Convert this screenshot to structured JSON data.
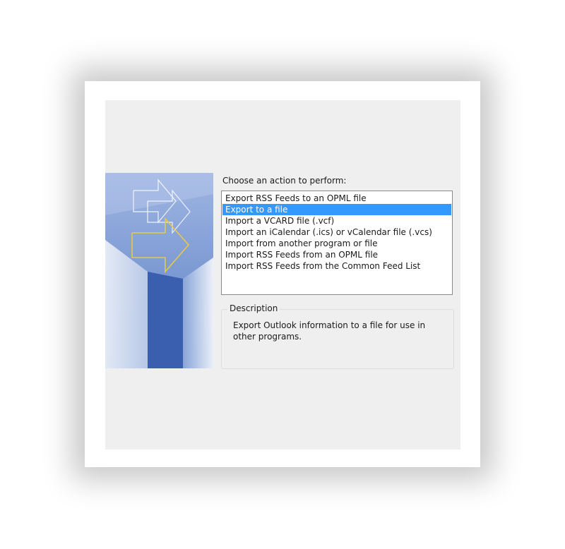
{
  "dialog": {
    "prompt": "Choose an action to perform:",
    "actions": [
      {
        "label": "Export RSS Feeds to an OPML file",
        "selected": false
      },
      {
        "label": "Export to a file",
        "selected": true
      },
      {
        "label": "Import a VCARD file (.vcf)",
        "selected": false
      },
      {
        "label": "Import an iCalendar (.ics) or vCalendar file (.vcs)",
        "selected": false
      },
      {
        "label": "Import from another program or file",
        "selected": false
      },
      {
        "label": "Import RSS Feeds from an OPML file",
        "selected": false
      },
      {
        "label": "Import RSS Feeds from the Common Feed List",
        "selected": false
      }
    ],
    "description": {
      "title": "Description",
      "text": "Export Outlook information to a file for use in other programs."
    }
  },
  "colors": {
    "selection": "#3399ff",
    "dialog_bg": "#efefef",
    "banner_blue": "#4a6fb9"
  },
  "icons": {
    "banner": "wizard-arrows-banner"
  }
}
